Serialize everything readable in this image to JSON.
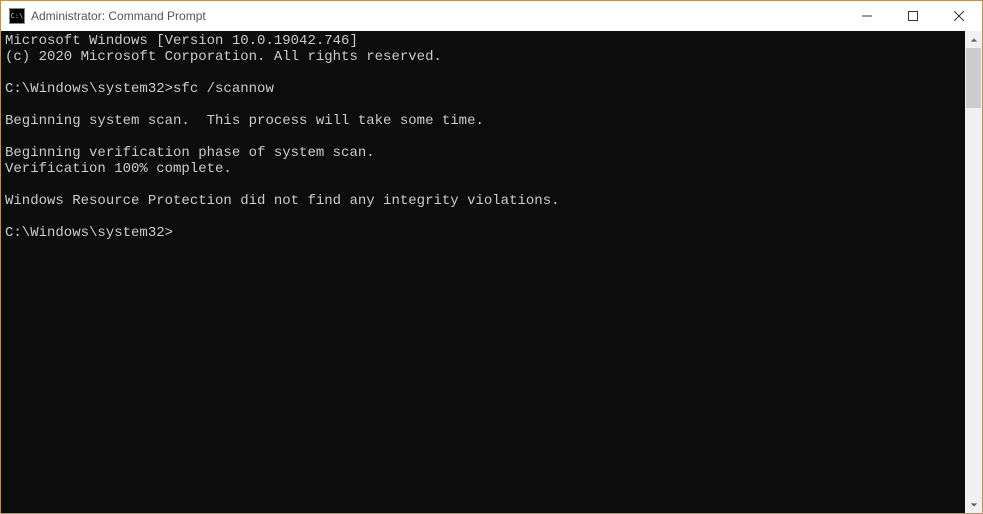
{
  "titlebar": {
    "icon_label": "C:\\",
    "title": "Administrator: Command Prompt"
  },
  "console": {
    "lines": [
      "Microsoft Windows [Version 10.0.19042.746]",
      "(c) 2020 Microsoft Corporation. All rights reserved.",
      "",
      "C:\\Windows\\system32>sfc /scannow",
      "",
      "Beginning system scan.  This process will take some time.",
      "",
      "Beginning verification phase of system scan.",
      "Verification 100% complete.",
      "",
      "Windows Resource Protection did not find any integrity violations.",
      "",
      "C:\\Windows\\system32>"
    ]
  }
}
